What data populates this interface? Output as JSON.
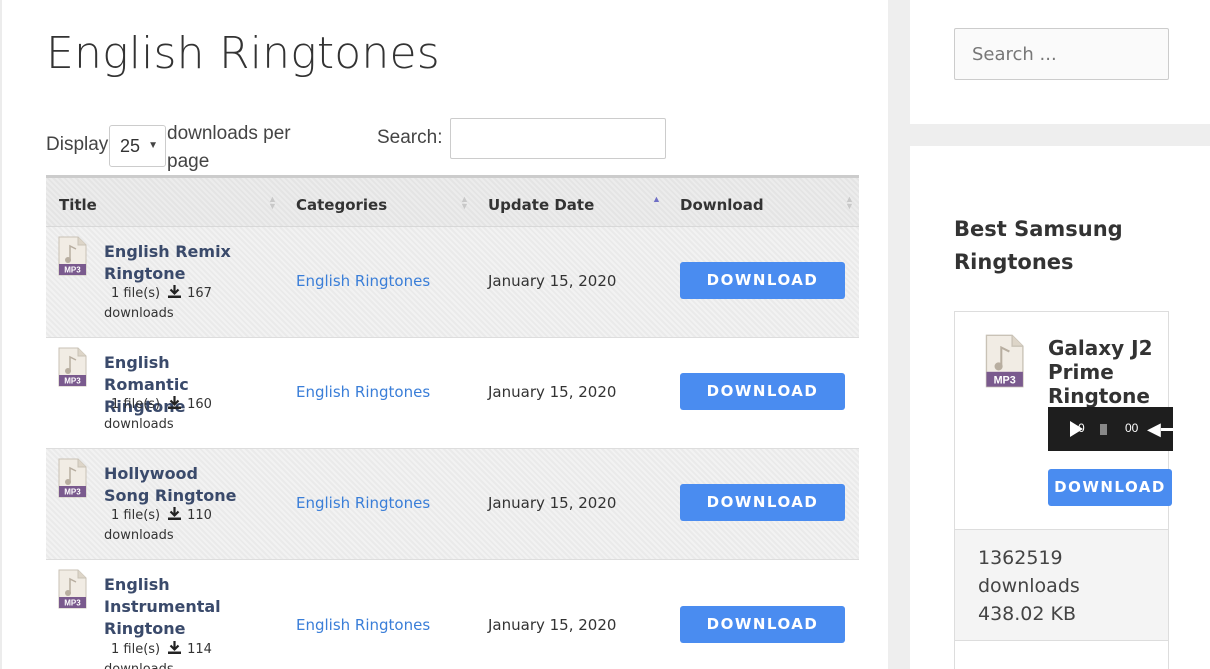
{
  "page": {
    "title": "English Ringtones"
  },
  "controls": {
    "display_label": "Display",
    "display_value": "25",
    "display_suffix": "downloads per page",
    "search_label": "Search:",
    "search_value": ""
  },
  "table": {
    "headers": {
      "title": "Title",
      "categories": "Categories",
      "update_date": "Update Date",
      "download": "Download"
    },
    "rows": [
      {
        "title": "English Remix Ringtone",
        "files": "1 file(s)",
        "downloads_count": "167",
        "downloads_label": "downloads",
        "category": "English Ringtones",
        "date": "January 15, 2020",
        "button": "DOWNLOAD"
      },
      {
        "title": "English Romantic Ringtone",
        "files": "1 file(s)",
        "downloads_count": "160",
        "downloads_label": "downloads",
        "category": "English Ringtones",
        "date": "January 15, 2020",
        "button": "DOWNLOAD"
      },
      {
        "title": "Hollywood Song Ringtone",
        "files": "1 file(s)",
        "downloads_count": "110",
        "downloads_label": "downloads",
        "category": "English Ringtones",
        "date": "January 15, 2020",
        "button": "DOWNLOAD"
      },
      {
        "title": "English Instrumental Ringtone",
        "files": "1 file(s)",
        "downloads_count": "114",
        "downloads_label": "downloads",
        "category": "English Ringtones",
        "date": "January 15, 2020",
        "button": "DOWNLOAD"
      }
    ]
  },
  "sidebar": {
    "search_placeholder": "Search ...",
    "widget_title": "Best Samsung Ringtones",
    "card": {
      "title": "Galaxy J2 Prime Ringtone",
      "time_current": "0",
      "time_total": "00",
      "button": "DOWNLOAD",
      "downloads_count": "1362519",
      "downloads_label": "downloads",
      "size": "438.02 KB"
    }
  },
  "icons": {
    "file": "mp3-file-icon",
    "download": "download-arrow-icon",
    "sort": "sort-icon"
  },
  "colors": {
    "accent": "#4a8cf0",
    "link": "#3a7ed8",
    "title": "#3a4a6b",
    "mp3_badge": "#7a5a8e"
  }
}
